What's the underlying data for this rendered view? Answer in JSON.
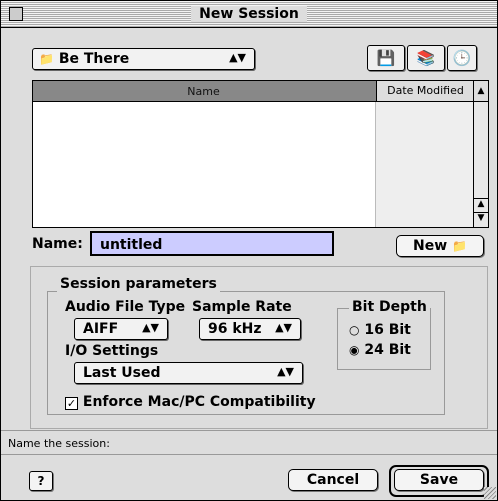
{
  "window": {
    "title": "New Session"
  },
  "location": {
    "folder": "Be There"
  },
  "file_list": {
    "col_name": "Name",
    "col_date": "Date Modified"
  },
  "name_field": {
    "label": "Name:",
    "value": "untitled"
  },
  "new_folder_button": {
    "label": "New"
  },
  "session_parameters": {
    "title": "Session parameters",
    "audio_file_type": {
      "label": "Audio File Type",
      "value": "AIFF"
    },
    "sample_rate": {
      "label": "Sample Rate",
      "value": "96 kHz"
    },
    "io_settings": {
      "label": "I/O Settings",
      "value": "Last Used"
    },
    "bit_depth": {
      "title": "Bit Depth",
      "opt16": "16 Bit",
      "opt24": "24 Bit",
      "selected": "24 Bit"
    },
    "enforce": {
      "label": "Enforce Mac/PC Compatibility",
      "checked": true
    }
  },
  "status": {
    "text": "Name the session:"
  },
  "buttons": {
    "cancel": "Cancel",
    "save": "Save"
  }
}
